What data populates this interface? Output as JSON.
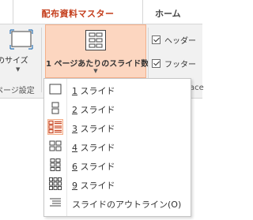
{
  "tabs": {
    "active": "配布資料マスター",
    "home": "ホーム"
  },
  "ribbon": {
    "slide_size_label": "のサイズ",
    "page_setup_group_label": "ページ設定",
    "slides_per_page_label": "1 ページあたりのスライド数",
    "header_checkbox": "ヘッダー",
    "footer_checkbox": "フッター",
    "cut_label": "ace"
  },
  "menu": {
    "items": [
      {
        "accel": "1",
        "label": " スライド",
        "icon": "one-slide-icon"
      },
      {
        "accel": "2",
        "label": " スライド",
        "icon": "two-slides-icon"
      },
      {
        "accel": "3",
        "label": " スライド",
        "icon": "three-slides-icon",
        "selected": true
      },
      {
        "accel": "4",
        "label": " スライド",
        "icon": "four-slides-icon"
      },
      {
        "accel": "6",
        "label": " スライド",
        "icon": "six-slides-icon"
      },
      {
        "accel": "9",
        "label": " スライド",
        "icon": "nine-slides-icon"
      },
      {
        "accel": "",
        "label": "スライドのアウトライン(O)",
        "icon": "outline-icon"
      }
    ]
  },
  "colors": {
    "accent": "#c43e1c",
    "highlight": "#fcd6c0",
    "highlight_border": "#f4b08b"
  }
}
